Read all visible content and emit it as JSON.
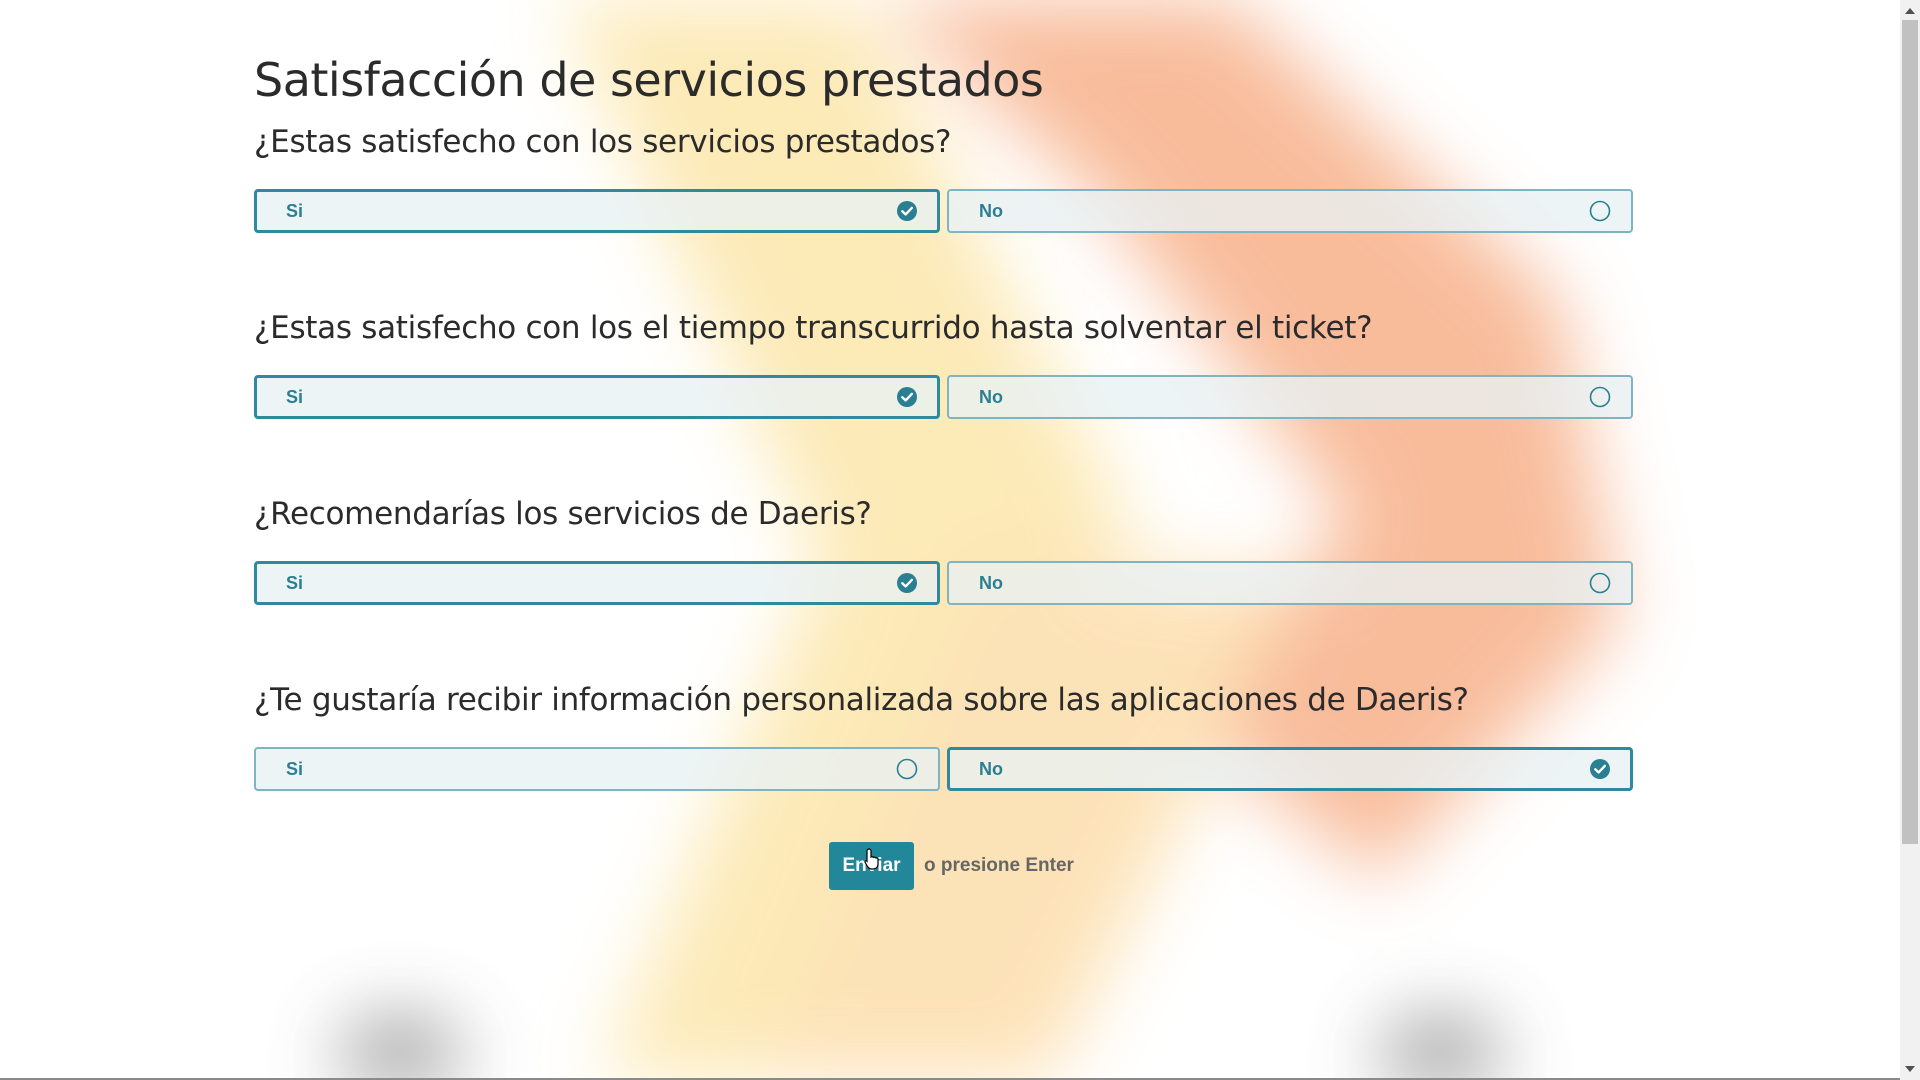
{
  "page": {
    "title": "Satisfacción de servicios prestados"
  },
  "questions": [
    {
      "label": "¿Estas satisfecho con los servicios prestados?",
      "options": [
        {
          "label": "Si",
          "selected": true,
          "icon": "check-circle-icon"
        },
        {
          "label": "No",
          "selected": false,
          "icon": "empty-circle-icon"
        }
      ]
    },
    {
      "label": "¿Estas satisfecho con los el tiempo transcurrido hasta solventar el ticket?",
      "options": [
        {
          "label": "Si",
          "selected": true,
          "icon": "check-circle-icon"
        },
        {
          "label": "No",
          "selected": false,
          "icon": "empty-circle-icon"
        }
      ]
    },
    {
      "label": "¿Recomendarías los servicios de Daeris?",
      "options": [
        {
          "label": "Si",
          "selected": true,
          "icon": "check-circle-icon"
        },
        {
          "label": "No",
          "selected": false,
          "icon": "empty-circle-icon"
        }
      ]
    },
    {
      "label": "¿Te gustaría recibir información personalizada sobre las aplicaciones de Daeris?",
      "options": [
        {
          "label": "Si",
          "selected": false,
          "icon": "empty-circle-icon"
        },
        {
          "label": "No",
          "selected": true,
          "icon": "check-circle-icon"
        }
      ]
    }
  ],
  "submit": {
    "label": "Enviar",
    "hint": "o presione Enter"
  },
  "colors": {
    "accent": "#23879a",
    "option_text": "#2a7f93",
    "option_border": "#7fb5c2",
    "option_bg": "#e8f1f4"
  }
}
